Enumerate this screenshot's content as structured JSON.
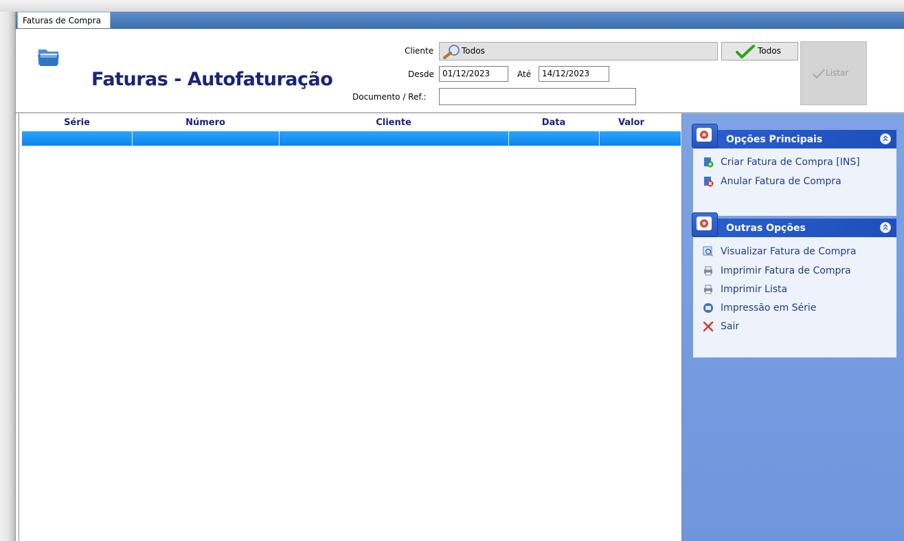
{
  "tab": {
    "label": "Faturas de Compra"
  },
  "header": {
    "title": "Faturas - Autofaturação",
    "cliente_label": "Cliente",
    "cliente_value": "Todos",
    "todos_button": "Todos",
    "desde_label": "Desde",
    "desde_value": "01/12/2023",
    "ate_label": "Até",
    "ate_value": "14/12/2023",
    "documento_label": "Documento / Ref.:",
    "documento_value": "",
    "listar_button": "Listar"
  },
  "grid": {
    "columns": [
      "Série",
      "Número",
      "Cliente",
      "Data",
      "Valor"
    ],
    "rows": []
  },
  "side_panel": {
    "groups": [
      {
        "title": "Opções Principais",
        "items": [
          {
            "label": "Criar Fatura de Compra [INS]",
            "icon": "create-doc-icon"
          },
          {
            "label": "Anular Fatura de Compra",
            "icon": "cancel-doc-icon"
          }
        ]
      },
      {
        "title": "Outras Opções",
        "items": [
          {
            "label": "Visualizar Fatura de Compra",
            "icon": "preview-icon"
          },
          {
            "label": "Imprimir Fatura de Compra",
            "icon": "printer-icon"
          },
          {
            "label": "Imprimir Lista",
            "icon": "printer-icon"
          },
          {
            "label": "Impressão em Série",
            "icon": "batch-print-icon"
          },
          {
            "label": "Sair",
            "icon": "close-icon"
          }
        ]
      }
    ]
  },
  "colors": {
    "title": "#1a237e",
    "tabstrip": "#3d6fb0",
    "selection_row": "#0d85ee",
    "side_panel": "#7ea3e4",
    "group_header": "#2a5fd0",
    "link": "#1f3b84"
  }
}
